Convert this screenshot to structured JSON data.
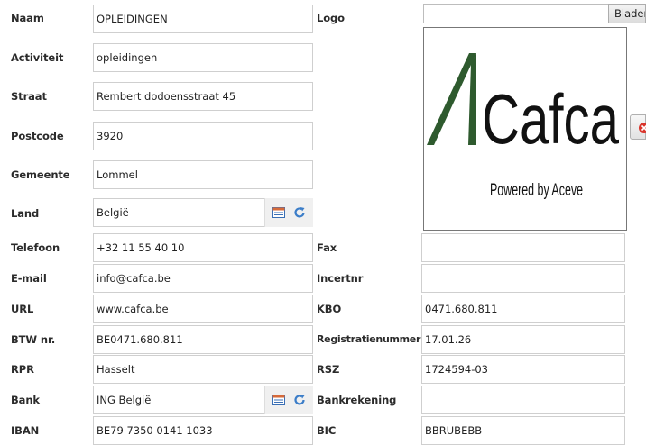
{
  "form": {
    "naam": {
      "label": "Naam",
      "value": "OPLEIDINGEN"
    },
    "activiteit": {
      "label": "Activiteit",
      "value": "opleidingen"
    },
    "straat": {
      "label": "Straat",
      "value": "Rembert dodoensstraat 45"
    },
    "postcode": {
      "label": "Postcode",
      "value": "3920"
    },
    "gemeente": {
      "label": "Gemeente",
      "value": "Lommel"
    },
    "land": {
      "label": "Land",
      "value": "België"
    },
    "telefoon": {
      "label": "Telefoon",
      "value": "+32 11 55 40 10"
    },
    "email": {
      "label": "E-mail",
      "value": "info@cafca.be"
    },
    "url": {
      "label": "URL",
      "value": "www.cafca.be"
    },
    "btw": {
      "label": "BTW nr.",
      "value": "BE0471.680.811"
    },
    "rpr": {
      "label": "RPR",
      "value": "Hasselt"
    },
    "bank": {
      "label": "Bank",
      "value": "ING België"
    },
    "iban": {
      "label": "IBAN",
      "value": "BE79 7350 0141 1033"
    },
    "logo": {
      "label": "Logo",
      "browse_label": "Bladeren...",
      "image_text": "Cafca",
      "image_tagline": "Powered by Aceve"
    },
    "fax": {
      "label": "Fax",
      "value": ""
    },
    "incertnr": {
      "label": "Incertnr",
      "value": ""
    },
    "kbo": {
      "label": "KBO",
      "value": "0471.680.811"
    },
    "registratienummer": {
      "label": "Registratienummer",
      "value": "17.01.26"
    },
    "rsz": {
      "label": "RSZ",
      "value": "1724594-03"
    },
    "bankrekening": {
      "label": "Bankrekening",
      "value": ""
    },
    "bic": {
      "label": "BIC",
      "value": "BBRUBEBB"
    }
  },
  "icons": {
    "lookup_list": "list-select-icon",
    "lookup_refresh": "refresh-icon",
    "remove_logo": "remove-icon"
  },
  "colors": {
    "logo_green": "#2e5a2e",
    "logo_black": "#111111",
    "remove_red": "#d9342b"
  }
}
